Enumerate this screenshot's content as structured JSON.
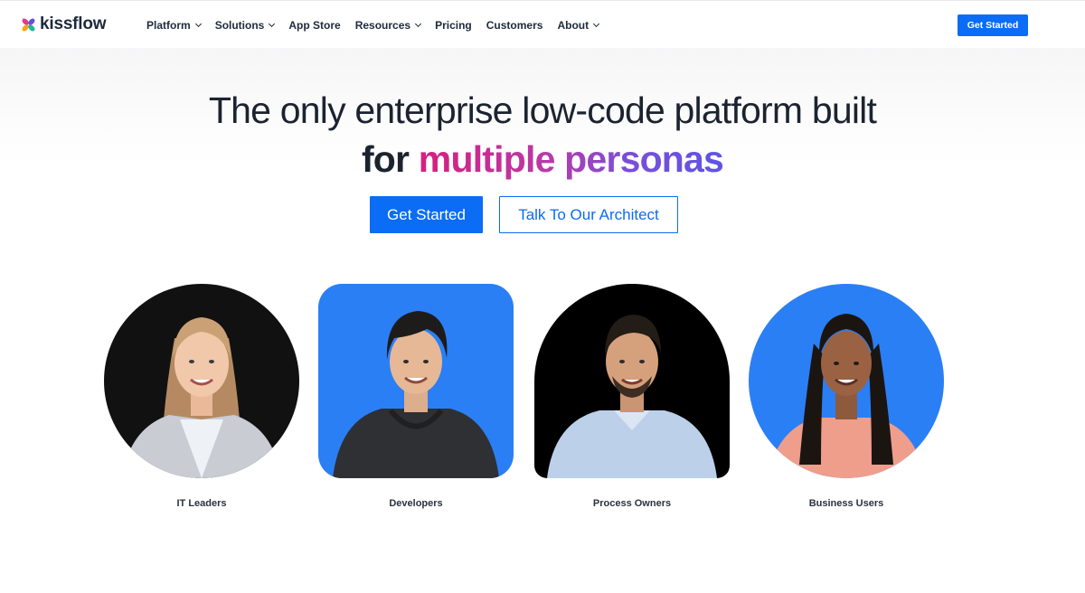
{
  "brand": {
    "name": "kissflow"
  },
  "nav": {
    "items": [
      {
        "label": "Platform",
        "dropdown": true
      },
      {
        "label": "Solutions",
        "dropdown": true
      },
      {
        "label": "App Store",
        "dropdown": false
      },
      {
        "label": "Resources",
        "dropdown": true
      },
      {
        "label": "Pricing",
        "dropdown": false
      },
      {
        "label": "Customers",
        "dropdown": false
      },
      {
        "label": "About",
        "dropdown": true
      }
    ],
    "cta_label": "Get Started"
  },
  "hero": {
    "headline_line1": "The only enterprise low-code platform built",
    "headline_line2_prefix": "for ",
    "headline_line2_highlight": "multiple personas",
    "primary_cta": "Get Started",
    "secondary_cta": "Talk To Our Architect"
  },
  "personas": [
    {
      "label": "IT Leaders",
      "background": "#111111"
    },
    {
      "label": "Developers",
      "background": "#2b7ff5"
    },
    {
      "label": "Process Owners",
      "background": "#000000"
    },
    {
      "label": "Business Users",
      "background": "#2b7ff5"
    }
  ],
  "colors": {
    "accent": "#0b6cf5",
    "text": "#1c2330",
    "gradient_start": "#d61f7f",
    "gradient_end": "#5e55e3"
  }
}
